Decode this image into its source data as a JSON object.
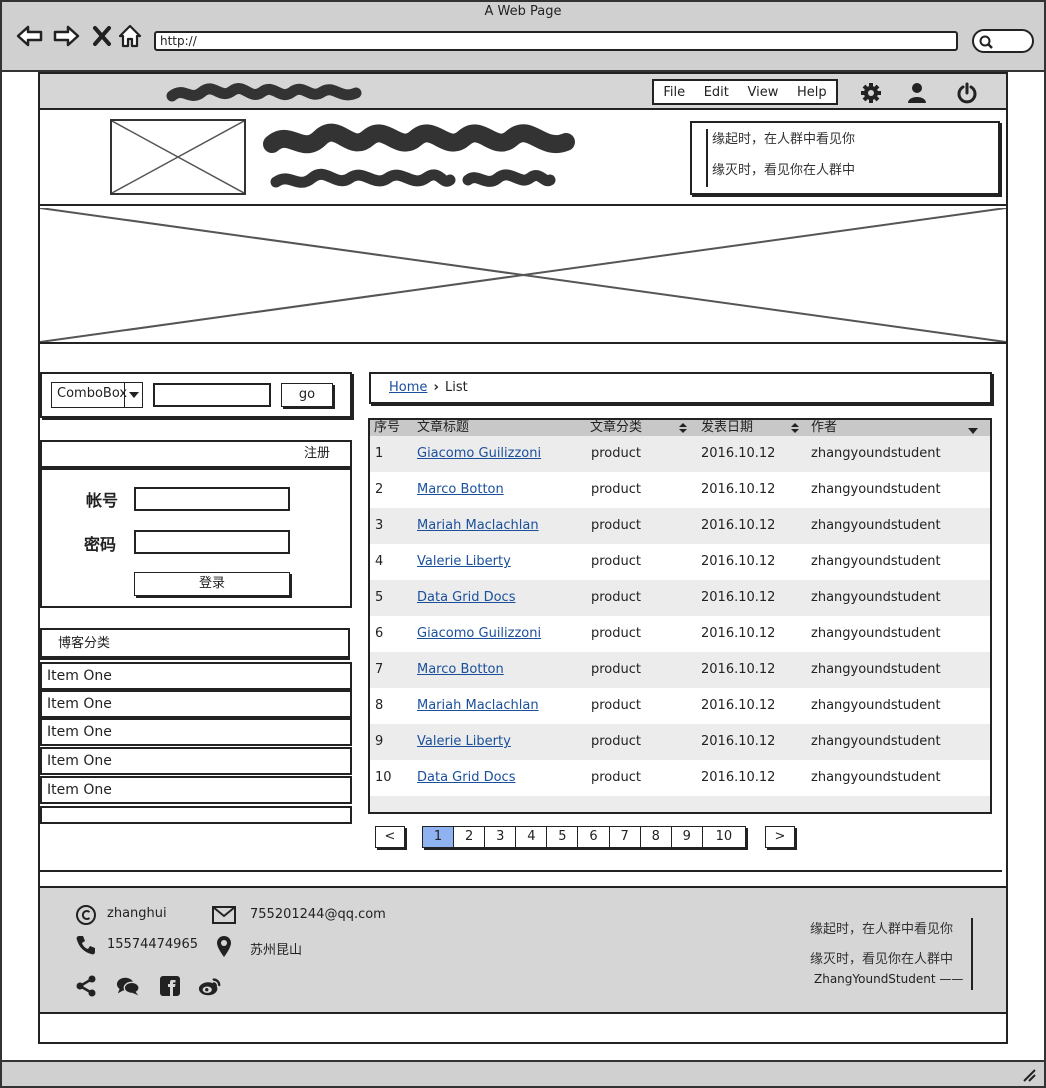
{
  "browser": {
    "window_title": "A Web Page",
    "url": "http://"
  },
  "menu": [
    "File",
    "Edit",
    "View",
    "Help"
  ],
  "header_quote": [
    "缘起时，在人群中看见你",
    "缘灭时，看见你在人群中"
  ],
  "search": {
    "combo_value": "ComboBox",
    "go_label": "go"
  },
  "login": {
    "register_label": "注册",
    "username_label": "帐号",
    "password_label": "密码",
    "submit_label": "登录"
  },
  "categories": {
    "title": "博客分类",
    "items": [
      "Item One",
      "Item One",
      "Item One",
      "Item One",
      "Item One"
    ]
  },
  "breadcrumb": {
    "home": "Home",
    "current": "List"
  },
  "table": {
    "columns": [
      "序号",
      "文章标题",
      "文章分类",
      "发表日期",
      "作者"
    ],
    "rows": [
      {
        "no": "1",
        "title": "Giacomo Guilizzoni",
        "category": "product",
        "date": "2016.10.12",
        "author": "zhangyoundstudent"
      },
      {
        "no": "2",
        "title": "Marco Botton",
        "category": "product",
        "date": "2016.10.12",
        "author": "zhangyoundstudent"
      },
      {
        "no": "3",
        "title": "Mariah Maclachlan",
        "category": "product",
        "date": "2016.10.12",
        "author": "zhangyoundstudent"
      },
      {
        "no": "4",
        "title": "Valerie Liberty",
        "category": "product",
        "date": "2016.10.12",
        "author": "zhangyoundstudent"
      },
      {
        "no": "5",
        "title": "Data Grid Docs",
        "category": "product",
        "date": "2016.10.12",
        "author": "zhangyoundstudent"
      },
      {
        "no": "6",
        "title": "Giacomo Guilizzoni",
        "category": "product",
        "date": "2016.10.12",
        "author": "zhangyoundstudent"
      },
      {
        "no": "7",
        "title": "Marco Botton",
        "category": "product",
        "date": "2016.10.12",
        "author": "zhangyoundstudent"
      },
      {
        "no": "8",
        "title": "Mariah Maclachlan",
        "category": "product",
        "date": "2016.10.12",
        "author": "zhangyoundstudent"
      },
      {
        "no": "9",
        "title": "Valerie Liberty",
        "category": "product",
        "date": "2016.10.12",
        "author": "zhangyoundstudent"
      },
      {
        "no": "10",
        "title": "Data Grid Docs",
        "category": "product",
        "date": "2016.10.12",
        "author": "zhangyoundstudent"
      }
    ]
  },
  "pagination": {
    "prev": "<",
    "next": ">",
    "pages": [
      "1",
      "2",
      "3",
      "4",
      "5",
      "6",
      "7",
      "8",
      "9",
      "10"
    ],
    "current": "1"
  },
  "footer": {
    "name": "zhanghui",
    "phone": "15574474965",
    "email": "755201244@qq.com",
    "location": "苏州昆山",
    "quote": [
      "缘起时，在人群中看见你",
      "缘灭时，看见你在人群中"
    ],
    "signature": "ZhangYoundStudent ——"
  },
  "colors": {
    "frame_gray": "#d0d0d0",
    "link_blue": "#1a4f9c",
    "active_page": "#8fb3f0",
    "row_alt": "#ececec"
  }
}
